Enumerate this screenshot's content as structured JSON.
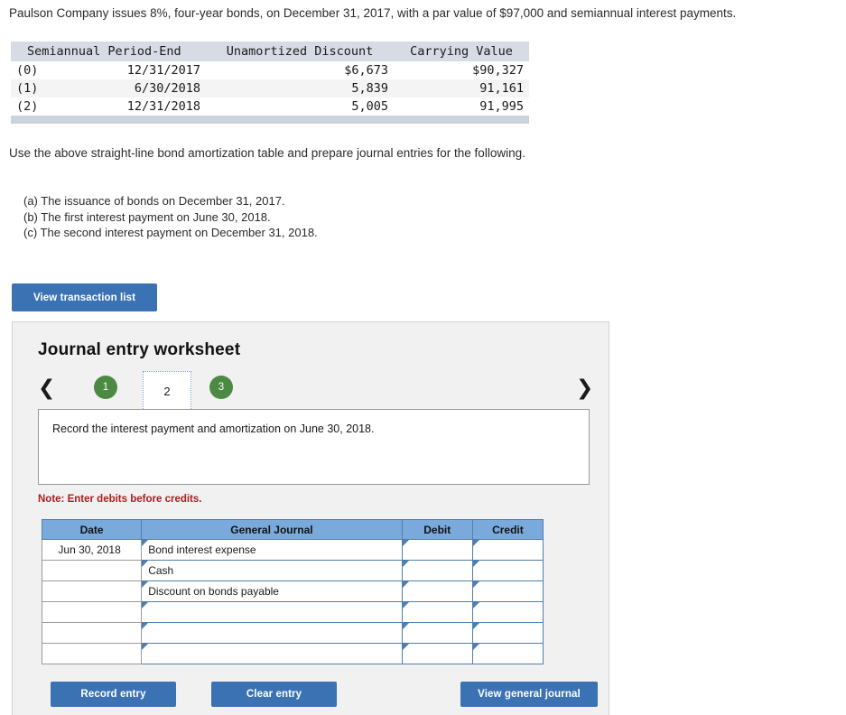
{
  "problem": {
    "statement": "Paulson Company issues 8%, four-year bonds, on December 31, 2017, with a par value of $97,000 and semiannual interest payments.",
    "instruction": "Use the above straight-line bond amortization table and prepare journal entries for the following.",
    "items": [
      "(a) The issuance of bonds on December 31, 2017.",
      "(b) The first interest payment on June 30, 2018.",
      "(c) The second interest payment on December 31, 2018."
    ]
  },
  "amortization_table": {
    "headers": [
      "Semiannual Period-End",
      "Unamortized Discount",
      "Carrying Value"
    ],
    "rows": [
      {
        "label": "(0)",
        "date": "12/31/2017",
        "discount": "$6,673",
        "carrying": "$90,327"
      },
      {
        "label": "(1)",
        "date": "6/30/2018",
        "discount": "5,839",
        "carrying": "91,161"
      },
      {
        "label": "(2)",
        "date": "12/31/2018",
        "discount": "5,005",
        "carrying": "91,995"
      }
    ]
  },
  "toolbar": {
    "view_transaction_list": "View transaction list"
  },
  "worksheet": {
    "title": "Journal entry worksheet",
    "prev_arrow": "❮",
    "next_arrow": "❯",
    "tabs": [
      {
        "label": "1",
        "state": "complete"
      },
      {
        "label": "2",
        "state": "active"
      },
      {
        "label": "3",
        "state": "complete"
      }
    ],
    "prompt": "Record the interest payment and amortization on June 30, 2018.",
    "note": "Note: Enter debits before credits.",
    "journal": {
      "columns": [
        "Date",
        "General Journal",
        "Debit",
        "Credit"
      ],
      "rows": [
        {
          "date": "Jun 30, 2018",
          "account": "Bond interest expense",
          "debit": "",
          "credit": ""
        },
        {
          "date": "",
          "account": "Cash",
          "debit": "",
          "credit": ""
        },
        {
          "date": "",
          "account": "Discount on bonds payable",
          "debit": "",
          "credit": ""
        },
        {
          "date": "",
          "account": "",
          "debit": "",
          "credit": ""
        },
        {
          "date": "",
          "account": "",
          "debit": "",
          "credit": ""
        },
        {
          "date": "",
          "account": "",
          "debit": "",
          "credit": ""
        }
      ]
    },
    "buttons": {
      "record_entry": "Record entry",
      "clear_entry": "Clear entry",
      "view_general_journal": "View general journal"
    }
  },
  "colors": {
    "button_blue": "#3a72b4",
    "table_header_blue": "#7aaadc",
    "tab_green": "#4c8a43",
    "note_red": "#a92020",
    "amort_header": "#d7dce4"
  }
}
